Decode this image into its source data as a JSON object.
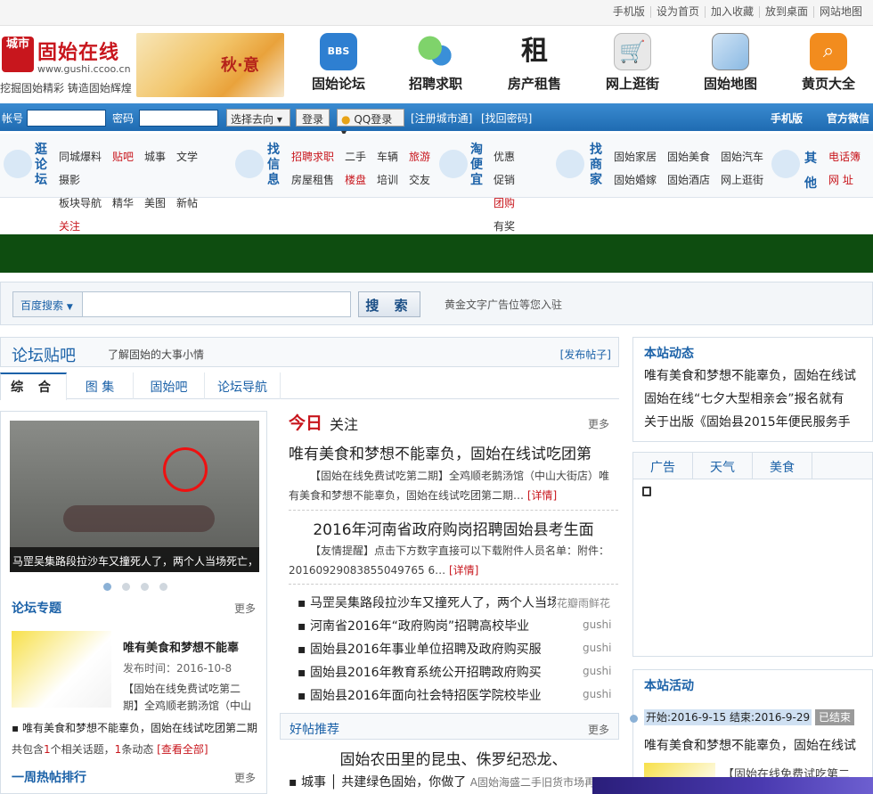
{
  "topbar": {
    "links": [
      "手机版",
      "设为首页",
      "加入收藏",
      "放到桌面",
      "网站地图"
    ]
  },
  "header": {
    "logo_mark": "城市",
    "logo_name": "固始在线",
    "logo_url": "www.gushi.ccoo.cn",
    "slogan": "挖掘固始精彩 铸造固始辉煌",
    "banner_text": "秋·意",
    "nav": [
      {
        "label": "固始论坛",
        "icon": "bbs-icon",
        "color": "#2e7fd1"
      },
      {
        "label": "招聘求职",
        "icon": "chat-bubbles-icon",
        "color": "#3aa94a"
      },
      {
        "label": "房产租售",
        "icon": "rent-icon",
        "color": "#222222"
      },
      {
        "label": "网上逛街",
        "icon": "shopping-cart-icon",
        "color": "#8a8a8a"
      },
      {
        "label": "固始地图",
        "icon": "map-icon",
        "color": "#4a90d9"
      },
      {
        "label": "黄页大全",
        "icon": "magnifier-icon",
        "color": "#f28c1e"
      }
    ]
  },
  "login": {
    "account_label": "帐号",
    "password_label": "密码",
    "goto_select": "选择去向",
    "login_button": "登录",
    "qq_login": "QQ登录",
    "register": "[注册城市通]",
    "forgot": "[找回密码]",
    "mobile": "手机版",
    "wechat": "官方微信"
  },
  "quick": {
    "groups": [
      {
        "title": "逛论坛",
        "rows": [
          [
            "同城爆料",
            "贴吧",
            "城事",
            "文学",
            "摄影"
          ],
          [
            "板块导航",
            "精华",
            "美图",
            "新帖",
            "关注"
          ]
        ]
      },
      {
        "title": "找信息",
        "rows": [
          [
            "招聘求职",
            "二手",
            "车辆",
            "旅游"
          ],
          [
            "房屋租售",
            "楼盘",
            "培训",
            "交友"
          ]
        ]
      },
      {
        "title": "淘便宜",
        "rows": [
          [
            "优惠",
            "促销"
          ],
          [
            "团购",
            "有奖"
          ]
        ]
      },
      {
        "title": "找商家",
        "rows": [
          [
            "固始家居",
            "固始美食",
            "固始汽车"
          ],
          [
            "固始婚嫁",
            "固始酒店",
            "网上逛街"
          ]
        ]
      },
      {
        "title": "其他",
        "rows": [
          [
            "电话簿"
          ],
          [
            "网 址"
          ]
        ]
      }
    ]
  },
  "search": {
    "type": "百度搜索",
    "button": "搜 索",
    "tip": "黄金文字广告位等您入驻"
  },
  "forum": {
    "title": "论坛贴吧",
    "subtitle": "了解固始的大事小情",
    "publish": "[发布帖子]",
    "tabs": [
      "综 合",
      "图 集",
      "固始吧",
      "论坛导航"
    ],
    "photo_caption": "马罡吴集路段拉沙车又撞死人了，两个人当场死亡，",
    "topics_title": "论坛专题",
    "more": "更多",
    "topic": {
      "title": "唯有美食和梦想不能辜",
      "date": "发布时间：2016-10-8",
      "desc": "【固始在线免费试吃第二期】全鸡顺老鹅汤馆（中山",
      "summary": "唯有美食和梦想不能辜负，固始在线试吃团第二期",
      "count_text_a": "共包含",
      "count_a": "1",
      "count_text_b": "个相关话题，",
      "count_b": "1",
      "count_text_c": "条动态",
      "view_all": "[查看全部]"
    },
    "hot_title": "一周热帖排行"
  },
  "today": {
    "title_a": "今日",
    "title_b": "关注",
    "more": "更多",
    "headline1": "唯有美食和梦想不能辜负，固始在线试吃团第",
    "desc1": "【固始在线免费试吃第二期】全鸡顺老鹅汤馆（中山大街店）唯有美食和梦想不能辜负，固始在线试吃团第二期…",
    "detail1": "[详情]",
    "headline2": "2016年河南省政府购岗招聘固始县考生面",
    "desc2": "【友情提醒】点击下方数字直接可以下载附件人员名单：附件：20160929083855049765 6…",
    "detail2": "[详情]",
    "list": [
      {
        "text": "马罡吴集路段拉沙车又撞死人了，两个人当场",
        "src": "花瓣雨鲜花"
      },
      {
        "text": "河南省2016年“政府购岗”招聘高校毕业",
        "src": "gushi"
      },
      {
        "text": "固始县2016年事业单位招聘及政府购买服",
        "src": "gushi"
      },
      {
        "text": "固始县2016年教育系统公开招聘政府购买",
        "src": "gushi"
      },
      {
        "text": "固始县2016年面向社会特招医学院校毕业",
        "src": "gushi"
      }
    ],
    "recommend_title": "好帖推荐",
    "recommend_more": "更多",
    "recommend_headline": "固始农田里的昆虫、侏罗纪恐龙、",
    "recommend_row_a": "城事",
    "recommend_row_b": "共建绿色固始，你做了",
    "recommend_row_c": "A固始海盛二手旧货市场再"
  },
  "right": {
    "news_title": "本站动态",
    "news": [
      "唯有美食和梦想不能辜负，固始在线试",
      "固始在线“七夕大型相亲会”报名就有",
      "关于出版《固始县2015年便民服务手"
    ],
    "tabs": [
      "广告",
      "天气",
      "美食"
    ],
    "activity_title": "本站活动",
    "activity_time": "开始:2016-9-15 结束:2016-9-29",
    "activity_status": "已结束",
    "activity_line": "唯有美食和梦想不能辜负，固始在线试",
    "activity_desc": "【固始在线免费试吃第二"
  }
}
